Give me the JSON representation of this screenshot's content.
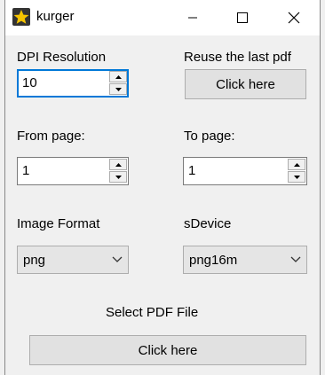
{
  "window": {
    "title": "kurger",
    "app_icon": "star-icon",
    "controls": [
      "minimize-icon",
      "maximize-icon",
      "close-icon"
    ]
  },
  "dpi": {
    "label": "DPI Resolution",
    "value": "10"
  },
  "reuse": {
    "label": "Reuse the last pdf",
    "button": "Click here"
  },
  "from_page": {
    "label": "From page:",
    "value": "1"
  },
  "to_page": {
    "label": "To page:",
    "value": "1"
  },
  "image_format": {
    "label": "Image Format",
    "selected": "png"
  },
  "sdevice": {
    "label": "sDevice",
    "selected": "png16m"
  },
  "select_pdf": {
    "label": "Select PDF File",
    "button": "Click here"
  }
}
